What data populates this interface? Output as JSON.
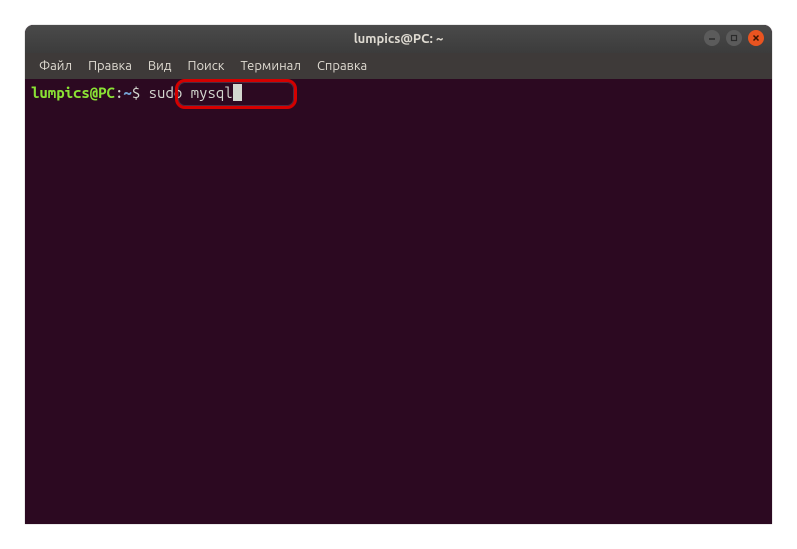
{
  "window": {
    "title": "lumpics@PC: ~"
  },
  "menubar": {
    "items": [
      "Файл",
      "Правка",
      "Вид",
      "Поиск",
      "Терминал",
      "Справка"
    ]
  },
  "terminal": {
    "prompt_user_host": "lumpics@PC",
    "prompt_colon": ":",
    "prompt_path": "~",
    "prompt_suffix": "$ ",
    "command": "sudo mysql"
  },
  "colors": {
    "terminal_bg": "#2c0921",
    "prompt_green": "#8ae234",
    "prompt_blue": "#729fcf",
    "text": "#d3d7cf",
    "close_btn": "#e95420",
    "highlight": "#d40000"
  }
}
